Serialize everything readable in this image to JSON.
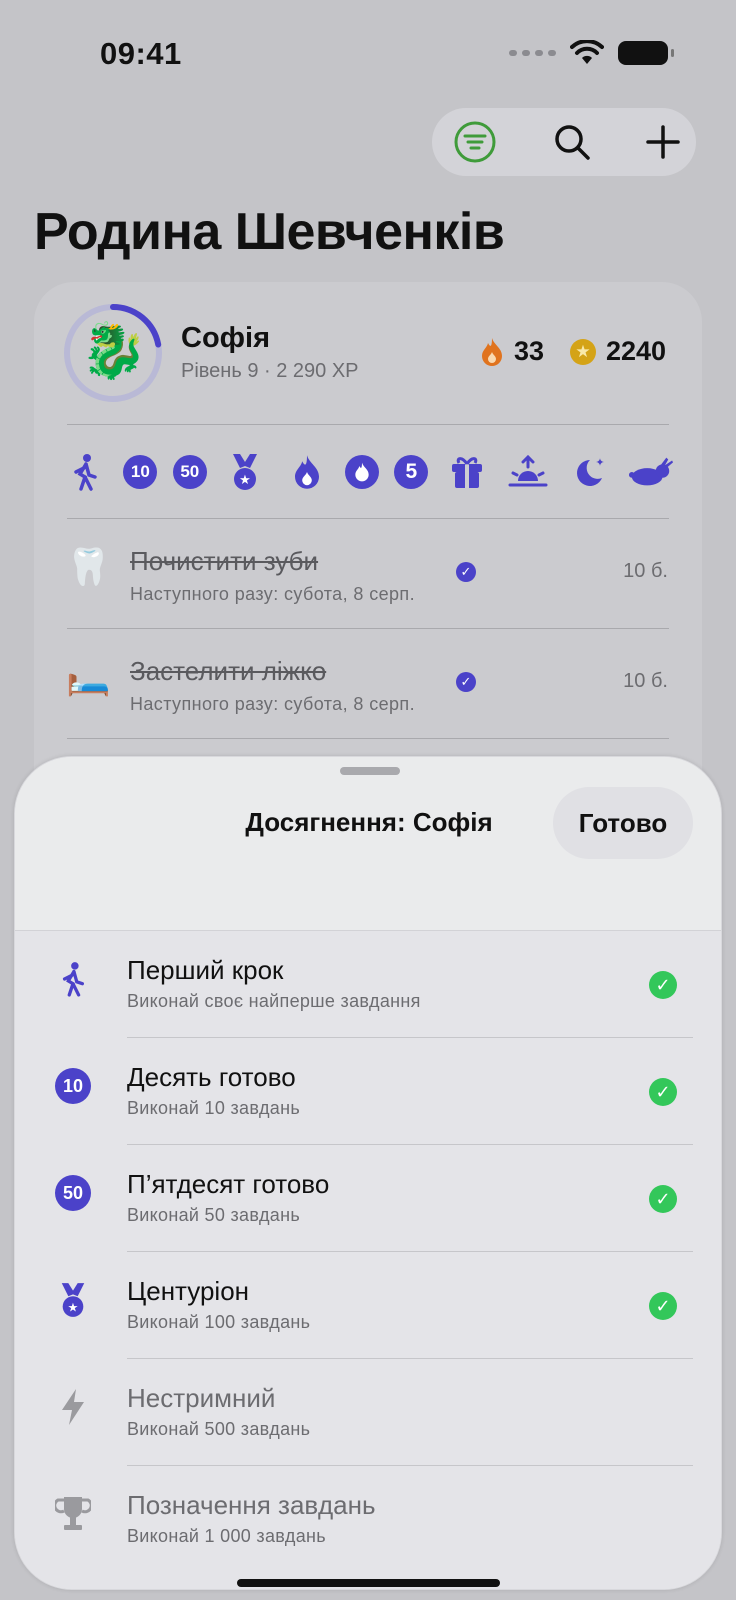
{
  "status_bar": {
    "time": "09:41"
  },
  "toolbar": {
    "filter_icon": "filter-icon",
    "search_icon": "search-icon",
    "add_icon": "plus-icon"
  },
  "page": {
    "title": "Родина Шевченків"
  },
  "member": {
    "avatar": "🐉",
    "name": "Софія",
    "level": "Рівень 9 · 2 290 XP",
    "level_progress": 0.22,
    "streak": "33",
    "coins": "2240"
  },
  "badges": [
    {
      "icon": "walking-icon",
      "label": ""
    },
    {
      "icon": "badge-10-icon",
      "label": "10"
    },
    {
      "icon": "badge-50-icon",
      "label": "50"
    },
    {
      "icon": "medal-icon",
      "label": ""
    },
    {
      "icon": "flame-icon",
      "label": ""
    },
    {
      "icon": "flame-circle-icon",
      "label": ""
    },
    {
      "icon": "badge-5-icon",
      "label": "5"
    },
    {
      "icon": "gift-icon",
      "label": ""
    },
    {
      "icon": "sunrise-icon",
      "label": ""
    },
    {
      "icon": "moon-stars-icon",
      "label": ""
    },
    {
      "icon": "hare-icon",
      "label": ""
    }
  ],
  "tasks": [
    {
      "emoji": "🦷",
      "title": "Почистити зуби",
      "next": "Наступного разу: субота, 8 серп.",
      "points": "10 б."
    },
    {
      "emoji": "🛏️",
      "title": "Застелити ліжко",
      "next": "Наступного разу: субота, 8 серп.",
      "points": "10 б."
    }
  ],
  "sheet": {
    "title": "Досягнення: Софія",
    "done_label": "Готово",
    "achievements": [
      {
        "icon": "walking-icon",
        "title": "Перший крок",
        "desc": "Виконай своє найперше завдання",
        "done": true
      },
      {
        "icon": "badge-10-icon",
        "badge_text": "10",
        "title": "Десять готово",
        "desc": "Виконай 10 завдань",
        "done": true
      },
      {
        "icon": "badge-50-icon",
        "badge_text": "50",
        "title": "П’ятдесят готово",
        "desc": "Виконай 50 завдань",
        "done": true
      },
      {
        "icon": "medal-icon",
        "title": "Центуріон",
        "desc": "Виконай 100 завдань",
        "done": true
      },
      {
        "icon": "bolt-icon",
        "title": "Нестримний",
        "desc": "Виконай 500 завдань",
        "done": false
      },
      {
        "icon": "trophy-icon",
        "title": "Позначення завдань",
        "desc": "Виконай 1 000 завдань",
        "done": false
      }
    ]
  },
  "colors": {
    "accent": "#4b42c9",
    "success": "#33c75a",
    "filter_active": "#3f9b3a",
    "streak": "#e0731e",
    "coin": "#d4a317"
  }
}
